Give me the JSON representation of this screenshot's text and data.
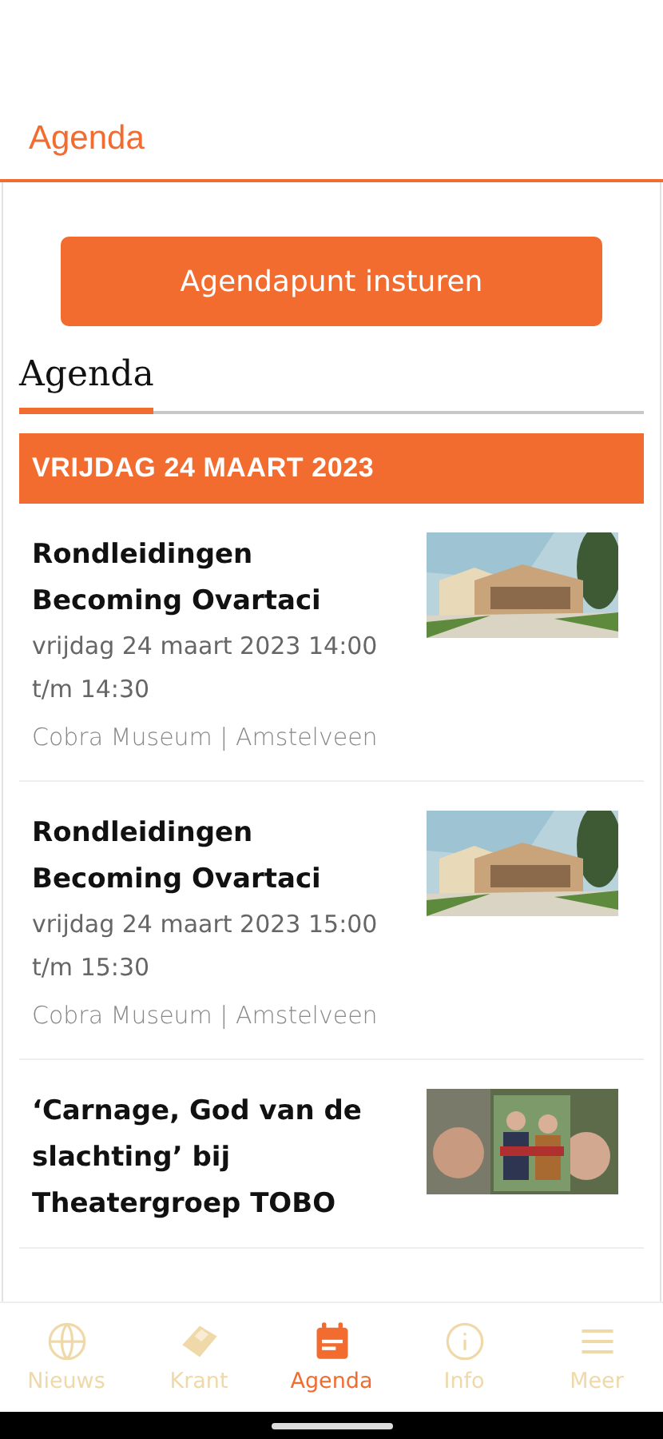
{
  "header": {
    "title": "Agenda"
  },
  "submit_button": {
    "label": "Agendapunt insturen"
  },
  "section": {
    "title": "Agenda"
  },
  "date_banner": "VRIJDAG 24 MAART 2023",
  "events": [
    {
      "title": "Rondleidingen Becoming Ovartaci",
      "time": "vrijdag 24 maart 2023 14:00 t/m 14:30",
      "location": "Cobra Museum | Amstelveen"
    },
    {
      "title": "Rondleidingen Becoming Ovartaci",
      "time": "vrijdag 24 maart 2023 15:00 t/m 15:30",
      "location": "Cobra Museum | Amstelveen"
    },
    {
      "title": "‘Carnage, God van de slachting’ bij Theatergroep TOBO"
    }
  ],
  "nav": [
    {
      "label": "Nieuws",
      "selected": false
    },
    {
      "label": "Krant",
      "selected": false
    },
    {
      "label": "Agenda",
      "selected": true
    },
    {
      "label": "Info",
      "selected": false
    },
    {
      "label": "Meer",
      "selected": false
    }
  ]
}
